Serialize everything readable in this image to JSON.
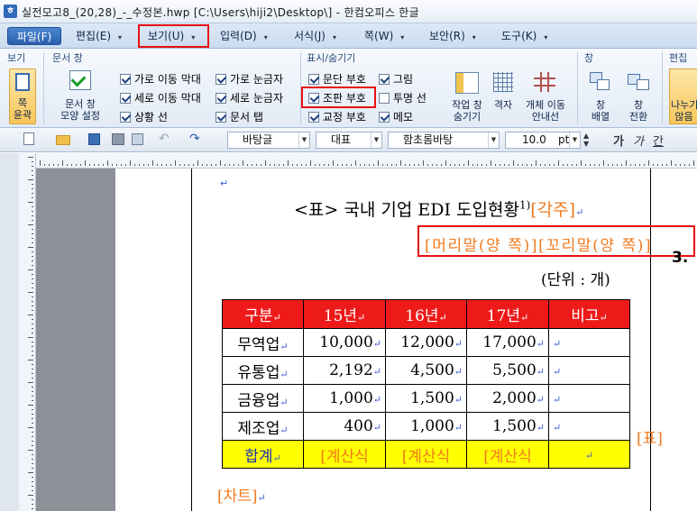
{
  "titlebar": {
    "icon": "hwp-icon",
    "title": "실전모고8_(20,28)_-_수정본.hwp [C:\\Users\\hiji2\\Desktop\\] - 한컴오피스 한글"
  },
  "menu": {
    "items": [
      {
        "label": "파일(F)",
        "name": "menu-file"
      },
      {
        "label": "편집(E)",
        "name": "menu-edit"
      },
      {
        "label": "보기(U)",
        "name": "menu-view"
      },
      {
        "label": "입력(D)",
        "name": "menu-insert"
      },
      {
        "label": "서식(J)",
        "name": "menu-format"
      },
      {
        "label": "쪽(W)",
        "name": "menu-page"
      },
      {
        "label": "보안(R)",
        "name": "menu-security"
      },
      {
        "label": "도구(K)",
        "name": "menu-tools"
      }
    ]
  },
  "ribbon": {
    "groups": {
      "view": "보기",
      "doc_window": "문서 창",
      "show_hide": "표시/숨기기",
      "window": "창",
      "edit": "편집"
    },
    "buttons": {
      "page_outline": "쪽\n윤곽",
      "doc_window_settings": "문서 창\n모양 설정",
      "work_window": "작업 창\n숨기기",
      "grid": "격자",
      "object_move": "개체 이동\n안내선",
      "window_layout": "창\n배열",
      "window_switch": "창\n전환",
      "split": "나누기\n않음"
    },
    "checks": [
      {
        "label": "가로 이동 막대",
        "checked": true
      },
      {
        "label": "세로 이동 막대",
        "checked": true
      },
      {
        "label": "상황 선",
        "checked": true
      },
      {
        "label": "가로 눈금자",
        "checked": true
      },
      {
        "label": "세로 눈금자",
        "checked": true
      },
      {
        "label": "문서 탭",
        "checked": true
      },
      {
        "label": "문단 부호",
        "checked": true
      },
      {
        "label": "조판 부호",
        "checked": true
      },
      {
        "label": "교정 부호",
        "checked": true
      },
      {
        "label": "그림",
        "checked": true
      },
      {
        "label": "투명 선",
        "checked": false
      },
      {
        "label": "메모",
        "checked": true
      }
    ]
  },
  "toolbar": {
    "style": "바탕글",
    "lang": "대표",
    "font": "함초롬바탕",
    "size": "10.0",
    "unit": "pt",
    "bold": "가",
    "italic": "가",
    "underline": "간"
  },
  "document": {
    "heading": "<표> 국내 기업 EDI 도입현황",
    "footnote_sup": "1)",
    "footnote_code": "[각주]",
    "header_footer_code": "[머리말(양 쪽)][꼬리말(양 쪽)]",
    "side_number": "3.",
    "unit_text": "(단위 : 개)",
    "table_code": "[표]",
    "chart_code": "[차트]",
    "table": {
      "headers": [
        "구분",
        "15년",
        "16년",
        "17년",
        "비고"
      ],
      "rows": [
        [
          "무역업",
          "10,000",
          "12,000",
          "17,000",
          ""
        ],
        [
          "유통업",
          "2,192",
          "4,500",
          "5,500",
          ""
        ],
        [
          "금융업",
          "1,000",
          "1,500",
          "2,000",
          ""
        ],
        [
          "제조업",
          "400",
          "1,000",
          "1,500",
          ""
        ]
      ],
      "total": [
        "합계",
        "[계산식",
        "[계산식",
        "[계산식",
        ""
      ]
    }
  },
  "colors": {
    "accent": "#2a5fae",
    "highlight_red": "#e81010",
    "header_red": "#ee1a1a",
    "total_yellow": "#ffff00",
    "code_orange": "#f07a1e"
  }
}
